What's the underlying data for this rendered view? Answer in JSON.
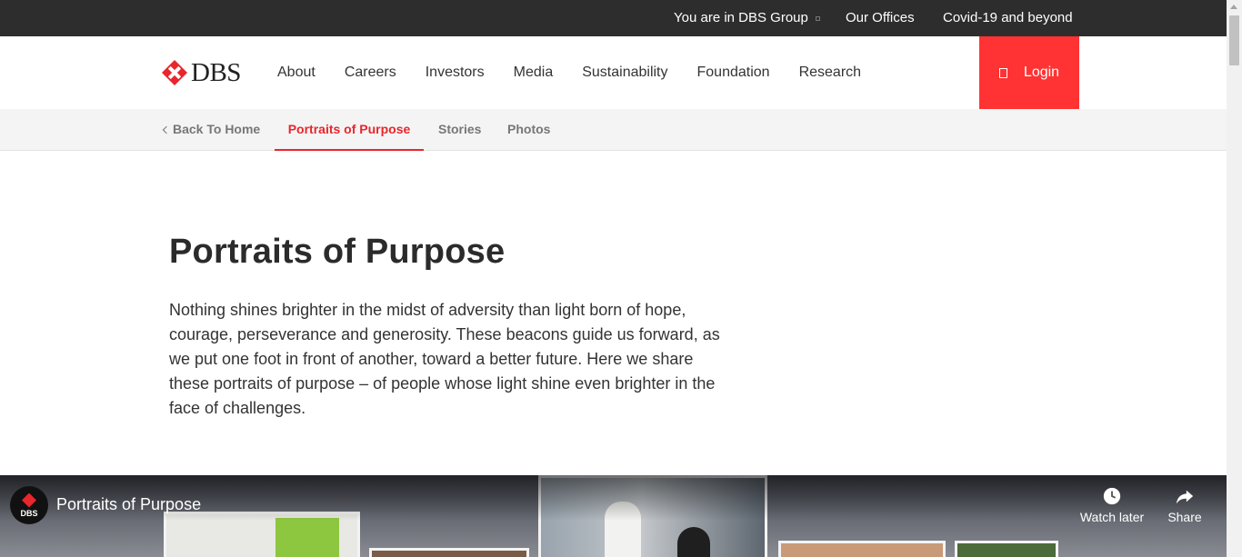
{
  "topbar": {
    "group": "You are in DBS Group",
    "offices": "Our Offices",
    "covid": "Covid-19 and beyond"
  },
  "nav": {
    "logo_text": "DBS",
    "items": [
      "About",
      "Careers",
      "Investors",
      "Media",
      "Sustainability",
      "Foundation",
      "Research"
    ],
    "login": "Login"
  },
  "subnav": {
    "back": "Back To Home",
    "active": "Portraits of Purpose",
    "stories": "Stories",
    "photos": "Photos"
  },
  "content": {
    "title": "Portraits of Purpose",
    "intro": "Nothing shines brighter in the midst of adversity than light born of hope, courage, perseverance and generosity. These beacons guide us forward, as we put one foot in front of another, toward a better future. Here we share these portraits of purpose – of people whose light shine even brighter in the face of challenges."
  },
  "video": {
    "channel": "DBS",
    "title": "Portraits of Purpose",
    "watch_later": "Watch later",
    "share": "Share"
  },
  "colors": {
    "brand_red": "#ff3333",
    "topbar": "#2d2d2d"
  }
}
